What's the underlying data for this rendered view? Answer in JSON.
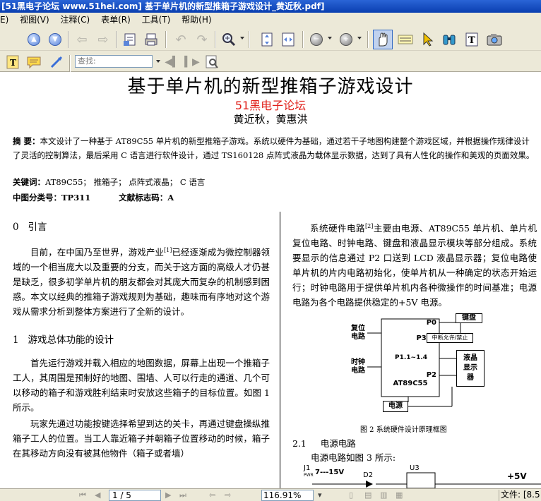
{
  "window": {
    "title": "[51黑电子论坛 www.51hei.com] 基于单片机的新型推箱子游戏设计_黄近秋.pdf]"
  },
  "menu": {
    "items": [
      "E)",
      "视图(V)",
      "注释(C)",
      "表单(R)",
      "工具(T)",
      "帮助(H)"
    ]
  },
  "toolbar": {
    "search_placeholder": "查找:",
    "icons": [
      "up-arrow-icon",
      "down-arrow-icon",
      "back-icon",
      "forward-icon",
      "save-icon",
      "print-icon",
      "undo-icon",
      "redo-icon",
      "zoom-icon",
      "fit-page-icon",
      "fit-width-icon",
      "zoom-out-icon",
      "zoom-in-icon",
      "hand-icon",
      "select-text-icon",
      "arrow-icon",
      "binoculars-icon",
      "text-select-icon",
      "snapshot-icon",
      "note-icon",
      "comment-icon",
      "pen-icon",
      "find-prev-icon",
      "find-next-icon",
      "find-icon"
    ]
  },
  "document": {
    "title": "基于单片机的新型推箱子游戏设计",
    "forum": "51黑电子论坛",
    "authors": "黄近秋，黄惠洪",
    "abstract_label": "摘  要：",
    "abstract": "本文设计了一种基于 AT89C55 单片机的新型推箱子游戏。系统以硬件为基础，通过若干子地图构建整个游戏区域，并根据操作规律设计了灵活的控制算法，最后采用 C 语言进行软件设计，通过 TS160128 点阵式液晶为载体显示数据，达到了具有人性化的操作和美观的页面效果。",
    "keywords_label": "关键词：",
    "keywords": "AT89C55；  推箱子；  点阵式液晶；  C 语言",
    "classification_label": "中图分类号：",
    "classification": "TP311",
    "doc_code_label": "文献标志码：",
    "doc_code": "A",
    "left": {
      "sec0_heading": "0   引言",
      "sec0_para_a": "目前，在中国乃至世界，游戏产业",
      "sec0_para_ref": "[1]",
      "sec0_para_b": "已经逐渐成为微控制器领域的一个相当庞大以及重要的分支，而关于这方面的高级人才仍甚是缺乏，很多初学单片机的朋友都会对其庞大而复杂的机制感到困惑。本文以经典的推箱子游戏规则为基础，趣味而有序地对这个游戏从需求分析到整体方案进行了全新的设计。",
      "sec1_heading": "1   游戏总体功能的设计",
      "sec1_para1": "首先运行游戏并载入相应的地图数据，屏幕上出现一个推箱子工人，其周围是预制好的地图、围墙、人可以行走的通道、几个可以移动的箱子和游戏胜利结束时安放这些箱子的目标位置。如图 1 所示。",
      "sec1_para2": "玩家先通过功能按键选择希望到达的关卡，再通过键盘操纵推箱子工人的位置。当工人靠近箱子并朝箱子位置移动的时候，箱子在其移动方向没有被其他物件（箱子或者墙）"
    },
    "right": {
      "para_a": "系统硬件电路",
      "para_ref": "[2]",
      "para_b": "主要由电源、AT89C55 单片机、单片机复位电路、时钟电路、键盘和液晶显示模块等部分组成。系统要显示的信息通过 P2 口送到 LCD 液晶显示器；复位电路使单片机的片内电路初始化，使单片机从一种确定的状态开始运行；时钟电路用于提供单片机内各种微操作的时间基准；电源电路为各个电路提供稳定的+5V 电源。",
      "diagram": {
        "keyboard": "键盘",
        "reset": "复位\n电路",
        "clock": "时钟\n电路",
        "p0": "P0",
        "p33": "P3. 3",
        "interrupt": "中断允许/禁止",
        "p11_14": "P1.1~1.4",
        "p2": "P2",
        "mcu": "AT89C55",
        "lcd": "液晶\n显示\n器",
        "power": "电源"
      },
      "fig2_caption": "图 2    系统硬件设计原理框图",
      "sec21_heading": "2.1     电源电路",
      "sec21_text": "电源电路如图 3 所示:",
      "circuit": {
        "j1": "J1",
        "pwr": "PWR",
        "voltage_in": "7---15V",
        "d2": "D2",
        "u3": "U3",
        "plus5v": "+5V"
      }
    }
  },
  "statusbar": {
    "page": "1 / 5",
    "zoom": "116.91%",
    "file_label": "文件: [8.5"
  }
}
